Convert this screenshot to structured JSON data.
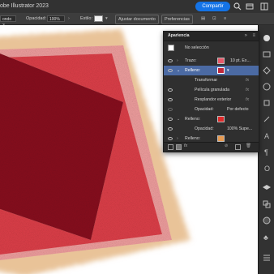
{
  "app": {
    "title": "obe Illustrator 2023",
    "share_label": "Compartir"
  },
  "controlbar": {
    "brush_value": "ondo 3...",
    "opacity_label": "Opacidad:",
    "opacity_value": "100%",
    "style_label": "Estilo:",
    "adjust_doc_label": "Ajustar documento",
    "prefs_label": "Preferencias"
  },
  "appearance_panel": {
    "tab_label": "Apariencia",
    "selection_label": "No selección",
    "rows": {
      "stroke_label": "Trazo:",
      "stroke_value": "10 pt. Ex...",
      "fill1_label": "Relleno:",
      "transform_label": "Transformar",
      "grain_label": "Película granulada",
      "outer_glow_label": "Resplandor exterior",
      "opacity_label": "Opacidad:",
      "opacity_value": "Por defecto",
      "fill2_label": "Relleno:",
      "opacity2_label": "Opacidad:",
      "opacity2_value": "100% Supe...",
      "fill3_label": "Relleno:",
      "fx_label": "fx"
    },
    "colors": {
      "stroke": "#e8596a",
      "fill1": "#c0283a",
      "fill2": "#e02a2a",
      "fill3": "#e89a50"
    }
  },
  "artwork_colors": {
    "outer": "#f0b0a8",
    "mid": "#e04048",
    "inner": "#8a1020",
    "grain": "#d8a060"
  }
}
